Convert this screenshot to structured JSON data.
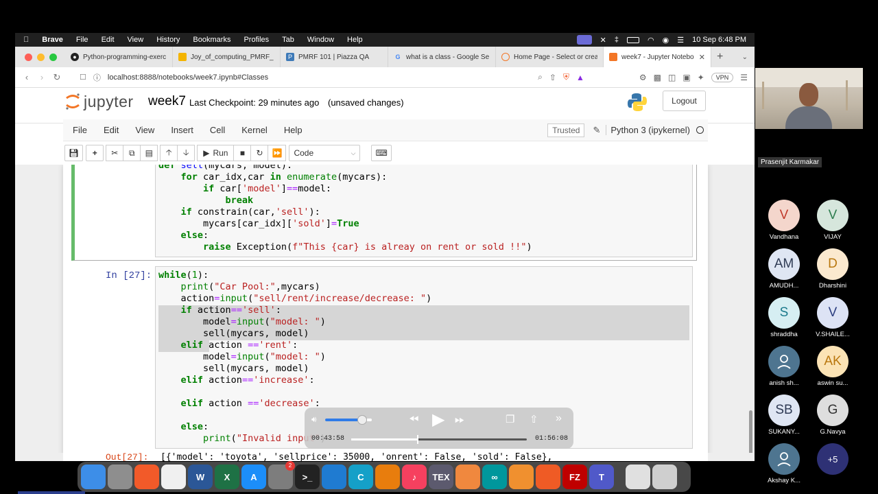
{
  "menubar": {
    "app": "Brave",
    "items": [
      "File",
      "Edit",
      "View",
      "History",
      "Bookmarks",
      "Profiles",
      "Tab",
      "Window",
      "Help"
    ],
    "datetime": "10 Sep  6:48 PM"
  },
  "tabs": [
    {
      "title": "Python-programming-exerc"
    },
    {
      "title": "Joy_of_computing_PMRF_"
    },
    {
      "title": "PMRF 101 | Piazza QA"
    },
    {
      "title": "what is a class - Google Se"
    },
    {
      "title": "Home Page - Select or crea"
    },
    {
      "title": "week7 - Jupyter Notebo"
    }
  ],
  "address": {
    "url": "localhost:8888/notebooks/week7.ipynb#Classes",
    "vpn_label": "VPN"
  },
  "jupyter": {
    "logo_text": "jupyter",
    "notebook_name": "week7",
    "checkpoint": "Last Checkpoint: 29 minutes ago",
    "unsaved": "(unsaved changes)",
    "logout": "Logout",
    "menu": [
      "File",
      "Edit",
      "View",
      "Insert",
      "Cell",
      "Kernel",
      "Help"
    ],
    "trusted": "Trusted",
    "kernel": "Python 3 (ipykernel)",
    "toolbar": {
      "run": "Run",
      "cell_type": "Code"
    }
  },
  "cells": {
    "cell1": {
      "lines": [
        "def sell(mycars, model):",
        "    for car_idx,car in enumerate(mycars):",
        "        if car['model']==model:",
        "            break",
        "    if constrain(car,'sell'):",
        "        mycars[car_idx]['sold']=True",
        "    else:",
        "        raise Exception(f\"This {car} is alreay on rent or sold !!\")"
      ]
    },
    "cell2": {
      "prompt": "In [27]:",
      "lines": [
        "while(1):",
        "    print(\"Car Pool:\",mycars)",
        "    action=input(\"sell/rent/increase/decrease: \")",
        "    if action=='sell':",
        "        model=input(\"model: \")",
        "        sell(mycars, model)",
        "    elif action =='rent':",
        "        model=input(\"model: \")",
        "        sell(mycars, model)",
        "    elif action=='increase':",
        "",
        "    elif action =='decrease':",
        "",
        "    else:",
        "        print(\"Invalid input\")"
      ],
      "out_prompt": "Out[27]:",
      "output": "[{'model': 'toyota', 'sellprice': 35000, 'onrent': False, 'sold': False},"
    }
  },
  "media": {
    "current_time": "00:43:58",
    "total_time": "01:56:08",
    "progress": 0.379,
    "volume": 0.8
  },
  "dock": [
    {
      "name": "finder",
      "label": "",
      "color": "#3d8ee8"
    },
    {
      "name": "launchpad",
      "label": "",
      "color": "#8e8e8e"
    },
    {
      "name": "brave",
      "label": "",
      "color": "#f25a29"
    },
    {
      "name": "freeform",
      "label": "",
      "color": "#f0f0f0"
    },
    {
      "name": "word",
      "label": "W",
      "color": "#2b5797"
    },
    {
      "name": "excel",
      "label": "X",
      "color": "#1e7145"
    },
    {
      "name": "app-store",
      "label": "A",
      "color": "#1c8ef9"
    },
    {
      "name": "system-settings",
      "label": "",
      "color": "#7d7d7d",
      "badge": "2"
    },
    {
      "name": "terminal",
      "label": ">_",
      "color": "#222222"
    },
    {
      "name": "vscode",
      "label": "",
      "color": "#1f7bd1"
    },
    {
      "name": "c-app",
      "label": "C",
      "color": "#15a0c8"
    },
    {
      "name": "blender",
      "label": "",
      "color": "#e87d0d"
    },
    {
      "name": "music",
      "label": "♪",
      "color": "#f6405f"
    },
    {
      "name": "texshop",
      "label": "TEX",
      "color": "#5c5a6e"
    },
    {
      "name": "pen-app",
      "label": "",
      "color": "#f0883e"
    },
    {
      "name": "arduino",
      "label": "∞",
      "color": "#00979c"
    },
    {
      "name": "sourcetree",
      "label": "",
      "color": "#f0902f"
    },
    {
      "name": "postman",
      "label": "",
      "color": "#ef5b25"
    },
    {
      "name": "filezilla",
      "label": "FZ",
      "color": "#bf0000"
    },
    {
      "name": "teams",
      "label": "T",
      "color": "#5059c9"
    },
    {
      "name": "document",
      "label": "",
      "color": "#e0e0e0"
    },
    {
      "name": "trash",
      "label": "",
      "color": "#cfcfcf"
    }
  ],
  "meeting": {
    "self_name": "Prasenjit Karmakar",
    "participants": [
      {
        "initials": "V",
        "name": "Vandhana",
        "color": "#f4d6cc",
        "text_color": "#c0392b"
      },
      {
        "initials": "V",
        "name": "VIJAY",
        "color": "#d6e6dc",
        "text_color": "#2e7d4f"
      },
      {
        "initials": "AM",
        "name": "AMUDH...",
        "color": "#dfe6f3",
        "text_color": "#2f3b55"
      },
      {
        "initials": "D",
        "name": "Dharshini",
        "color": "#fbe9cf",
        "text_color": "#b9770e"
      },
      {
        "initials": "S",
        "name": "shraddha",
        "color": "#d6eef2",
        "text_color": "#1b7a8c"
      },
      {
        "initials": "V",
        "name": "V.SHAILE...",
        "color": "#dde3f5",
        "text_color": "#2c3e80"
      },
      {
        "initials": "",
        "name": "anish sh...",
        "color": "#4e7590",
        "text_color": "#ffffff"
      },
      {
        "initials": "AK",
        "name": "aswin su...",
        "color": "#fbe3b5",
        "text_color": "#b9770e"
      },
      {
        "initials": "SB",
        "name": "SUKANY...",
        "color": "#dfe6f3",
        "text_color": "#2f3b55"
      },
      {
        "initials": "G",
        "name": "G.Navya",
        "color": "#dedede",
        "text_color": "#333333"
      },
      {
        "initials": "",
        "name": "Akshay K...",
        "color": "#4e7590",
        "text_color": "#ffffff"
      },
      {
        "initials": "+5",
        "name": "",
        "color": "#2e3175",
        "text_color": "#ffffff"
      }
    ]
  }
}
